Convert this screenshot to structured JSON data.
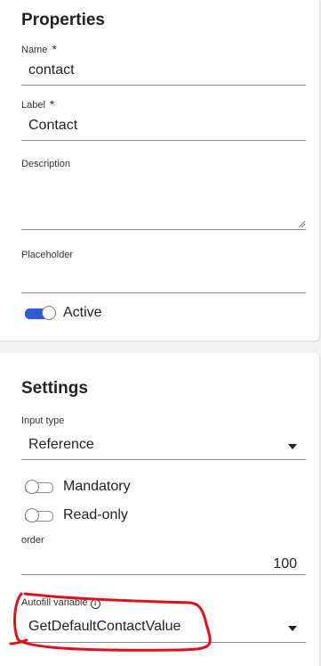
{
  "properties": {
    "title": "Properties",
    "name": {
      "label": "Name",
      "required_mark": "*",
      "value": "contact"
    },
    "label_field": {
      "label": "Label",
      "required_mark": "*",
      "value": "Contact"
    },
    "description": {
      "label": "Description",
      "value": ""
    },
    "placeholder": {
      "label": "Placeholder",
      "value": ""
    },
    "active": {
      "label": "Active",
      "on": true
    }
  },
  "settings": {
    "title": "Settings",
    "input_type": {
      "label": "Input type",
      "value": "Reference"
    },
    "mandatory": {
      "label": "Mandatory",
      "on": false
    },
    "read_only": {
      "label": "Read-only",
      "on": false
    },
    "order": {
      "label": "order",
      "value": "100"
    },
    "autofill": {
      "label": "Autofill variable",
      "info_icon": "i",
      "value": "GetDefaultContactValue"
    }
  },
  "colors": {
    "toggle_on": "#2f5bd8",
    "annotation": "#e0101a"
  }
}
